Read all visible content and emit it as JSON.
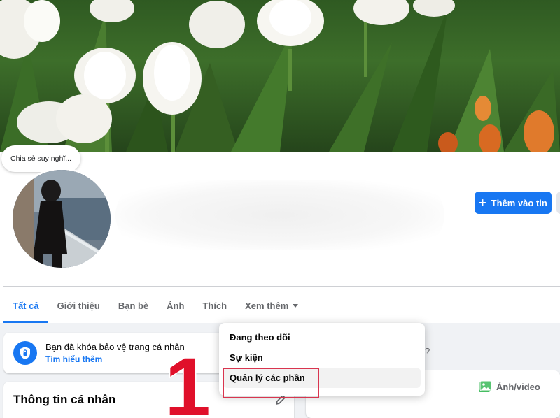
{
  "cover": {
    "description_icon": "cover-photo-tulips"
  },
  "status_bubble": {
    "text": "Chia sẻ suy nghĩ..."
  },
  "actions": {
    "add_story_label": "Thêm vào tin"
  },
  "tabs": [
    {
      "label": "Tất cả",
      "active": true
    },
    {
      "label": "Giới thiệu"
    },
    {
      "label": "Bạn bè"
    },
    {
      "label": "Ảnh"
    },
    {
      "label": "Thích"
    },
    {
      "label": "Xem thêm"
    }
  ],
  "dropdown": {
    "items": [
      {
        "label": "Đang theo dõi"
      },
      {
        "label": "Sự kiện"
      },
      {
        "label": "Quản lý các phần"
      }
    ]
  },
  "lock_notice": {
    "title": "Bạn đã khóa bảo vệ trang cá nhân",
    "link": "Tìm hiểu thêm"
  },
  "profile_info": {
    "title": "Thông tin cá nhân"
  },
  "composer": {
    "placeholder_tail": "?",
    "media_label": "Ảnh/video"
  },
  "annotation": {
    "step": "1"
  },
  "colors": {
    "accent": "#1877f2",
    "highlight": "#d9354f",
    "step_number": "#e0102a"
  }
}
